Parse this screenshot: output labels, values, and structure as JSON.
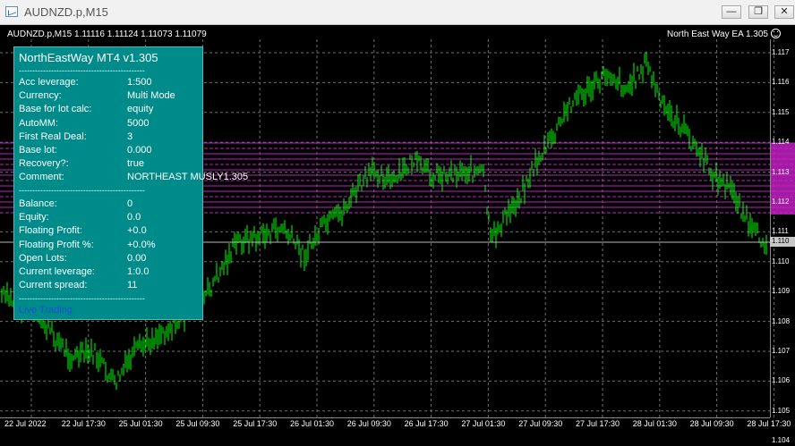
{
  "window": {
    "title": "AUDNZD.p,M15",
    "btn_minimize": "—",
    "btn_restore": "❐",
    "btn_close": "✕"
  },
  "chart": {
    "header": "AUDNZD.p,M15  1.11116 1.11124 1.11073 1.11079",
    "ea_label": "North East Way EA 1.305",
    "price_labels": [
      "1.117",
      "1.116",
      "1.115",
      "1.114",
      "1.113",
      "1.112",
      "1.111",
      "1.110",
      "1.109",
      "1.108",
      "1.107",
      "1.106",
      "1.105",
      "1.104"
    ],
    "current_price_label": "1.110",
    "time_labels": [
      "22 Jul 2022",
      "22 Jul 17:30",
      "25 Jul 01:30",
      "25 Jul 09:30",
      "25 Jul 17:30",
      "26 Jul 01:30",
      "26 Jul 09:30",
      "26 Jul 17:30",
      "27 Jul 01:30",
      "27 Jul 09:30",
      "27 Jul 17:30",
      "28 Jul 01:30",
      "28 Jul 09:30",
      "28 Jul 17:30"
    ],
    "colors": {
      "candle": "#00ff00",
      "grid": "#6e6e6e",
      "levels": "#c020c0",
      "current_price": "#b8b8b8"
    }
  },
  "panel": {
    "title": "NorthEastWay MT4 v1.305",
    "separator": "-----------------------------------------------",
    "rows_top": [
      {
        "key": "Acc leverage:",
        "value": "1:500"
      },
      {
        "key": "Currency:",
        "value": "Multi Mode"
      },
      {
        "key": "Base for lot calc:",
        "value": "equity"
      },
      {
        "key": "AutoMM:",
        "value": "5000"
      },
      {
        "key": "First Real Deal:",
        "value": "3"
      },
      {
        "key": "Base lot:",
        "value": "0.000"
      },
      {
        "key": "Recovery?:",
        "value": "true"
      },
      {
        "key": "Comment:",
        "value": "NORTHEAST MUSLY1.305"
      }
    ],
    "rows_bottom": [
      {
        "key": "Balance:",
        "value": "0"
      },
      {
        "key": "Equity:",
        "value": "0.0"
      },
      {
        "key": "Floating Profit:",
        "value": "+0.0"
      },
      {
        "key": "Floating Profit %:",
        "value": "+0.0%"
      },
      {
        "key": "Open Lots:",
        "value": "0.00"
      },
      {
        "key": "Current leverage:",
        "value": "1:0.0"
      },
      {
        "key": "Current spread:",
        "value": "11"
      }
    ],
    "status": "Live Trading"
  }
}
